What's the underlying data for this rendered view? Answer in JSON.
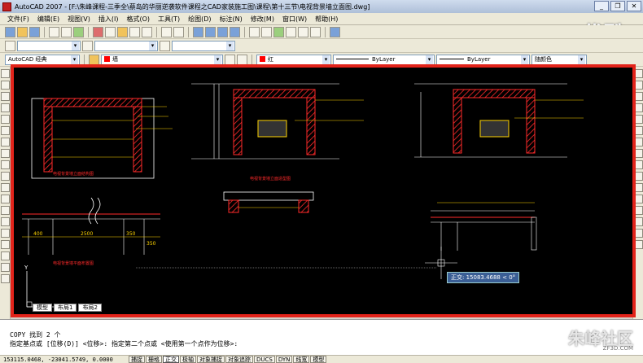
{
  "window": {
    "title": "AutoCAD 2007 - [F:\\朱峰课程-三季全\\蔡岛的华丽逆袭软件课程之CAD家装施工图\\课程\\第十三节\\电视背景墙立面图.dwg]",
    "minimize": "_",
    "restore": "❐",
    "close": "✕"
  },
  "watermark_top": "优酷",
  "menu": [
    "文件(F)",
    "编辑(E)",
    "视图(V)",
    "插入(I)",
    "格式(O)",
    "工具(T)",
    "绘图(D)",
    "标注(N)",
    "修改(M)",
    "窗口(W)",
    "帮助(H)"
  ],
  "toolbar": {
    "workspace": "AutoCAD 经典",
    "layer": "墙",
    "color": "红",
    "linetype": "ByLayer",
    "lineweight": "ByLayer",
    "plotstyle": "随颜色",
    "style_name": "A"
  },
  "drawing": {
    "title_left": "电视背景墙立面结构图",
    "title_mid": "电视背景墙立面造型图",
    "dims_left": [
      "400",
      "2500",
      "350"
    ],
    "dim_left_end": "350",
    "title_plan": "电视背景墙平面布置图",
    "axis_x": "X",
    "axis_y": "Y"
  },
  "tooltip": "正交: 15083.4688 < 0°",
  "layout_tabs": [
    "模型",
    "布局1",
    "布局2"
  ],
  "command": {
    "line1": "COPY 找到 2 个",
    "line2": "指定基点或 [位移(D)] <位移>:  指定第二个点或 <使用第一个点作为位移>:"
  },
  "watermark_bottom": "朱峰社区",
  "watermark_url": "ZF3D.COM",
  "status": {
    "coords": "153115.0468, -23041.5749, 0.0000",
    "buttons": [
      "捕捉",
      "栅格",
      "正交",
      "极轴",
      "对象捕捉",
      "对象追踪",
      "DUCS",
      "DYN",
      "线宽",
      "模型"
    ],
    "active": [
      "正交"
    ]
  },
  "colors": {
    "highlight_frame": "#e2231a",
    "canvas": "#000000",
    "red": "#ff2a2a",
    "yellow": "#ffd400",
    "white": "#ffffff"
  }
}
